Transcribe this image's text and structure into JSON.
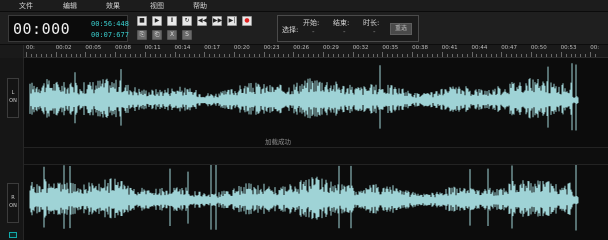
{
  "menu": [
    "文件",
    "编辑",
    "效果",
    "视图",
    "帮助"
  ],
  "time": {
    "main": "00:000",
    "total": "00:56:448",
    "position": "00:07:677"
  },
  "transport": {
    "row1": [
      {
        "name": "stop-button",
        "icon": "stop-icon",
        "glyph": "■"
      },
      {
        "name": "play-button",
        "icon": "play-icon",
        "glyph": "▶"
      },
      {
        "name": "pause-button",
        "icon": "pause-icon",
        "glyph": "Ⅱ"
      },
      {
        "name": "loop-button",
        "icon": "loop-icon",
        "glyph": "↻"
      },
      {
        "name": "rewind-button",
        "icon": "rewind-icon",
        "glyph": "◀◀"
      },
      {
        "name": "fast-forward-button",
        "icon": "fast-forward-icon",
        "glyph": "▶▶"
      },
      {
        "name": "skip-end-button",
        "icon": "skip-end-icon",
        "glyph": "▶|"
      },
      {
        "name": "record-button",
        "icon": "record-icon",
        "glyph": "●"
      }
    ],
    "row2": [
      {
        "name": "copy-button",
        "icon": "copy-icon",
        "glyph": "⎘"
      },
      {
        "name": "paste-button",
        "icon": "paste-icon",
        "glyph": "⎗"
      },
      {
        "name": "cut-button",
        "icon": "cut-icon",
        "glyph": "X"
      },
      {
        "name": "silence-button",
        "icon": "silence-icon",
        "glyph": "S"
      }
    ]
  },
  "selection": {
    "label": "选择:",
    "start_label": "开始:",
    "start_value": "-",
    "end_label": "结束:",
    "end_value": "-",
    "duration_label": "时长:",
    "duration_value": "-",
    "reset_label": "重选"
  },
  "ruler_labels": [
    "00:",
    "00:02",
    "00:05",
    "00:08",
    "00:11",
    "00:14",
    "00:17",
    "00:20",
    "00:23",
    "00:26",
    "00:29",
    "00:32",
    "00:35",
    "00:38",
    "00:41",
    "00:44",
    "00:47",
    "00:50",
    "00:53",
    "00:"
  ],
  "channels": [
    {
      "name": "L",
      "state": "ON"
    },
    {
      "name": "R",
      "state": "ON"
    }
  ],
  "status_message": "加载成功",
  "colors": {
    "waveform": "#9fd3d6",
    "record": "#e02020",
    "time_cyan": "#3ad0d0"
  }
}
